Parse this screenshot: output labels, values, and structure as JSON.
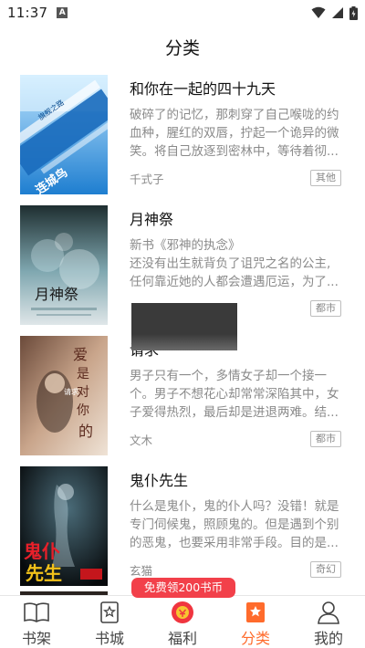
{
  "status_bar": {
    "time": "11:37",
    "notification_letter": "A"
  },
  "header": {
    "title": "分类"
  },
  "books": [
    {
      "title": "和你在一起的四十九天",
      "description_lines": [
        "破碎了的记忆，那刺穿了自己喉咙的约",
        "血种，腥红的双唇，拧起一个诡异的微",
        "笑。将自己放逐到密林中，等待着彻..."
      ],
      "author": "千式子",
      "tag": "其他",
      "cover_text": [
        "旗舰之路",
        "连城鸟"
      ]
    },
    {
      "title": "月神祭",
      "description_lines": [
        "新书《邪神的执念》",
        "还没有出生就背负了诅咒之名的公主,",
        "任何靠近她的人都会遭遇厄运，为了..."
      ],
      "author": "",
      "tag": "都市",
      "cover_text": [
        "月神祭"
      ]
    },
    {
      "title": "请求",
      "description_lines": [
        "男子只有一个，多情女子却一个接一",
        "个。男子不想花心却常常深陷其中，女",
        "子爱得热烈，最后却是进退两难。结..."
      ],
      "author": "文木",
      "tag": "都市",
      "cover_text": [
        "爱",
        "是",
        "对",
        "你",
        "的",
        "请求"
      ]
    },
    {
      "title": "鬼仆先生",
      "description_lines": [
        "什么是鬼仆，鬼的仆人吗？没错！就是",
        "专门伺候鬼，照顾鬼的。但是遇到个别",
        "的恶鬼，也要采用非常手段。目的是..."
      ],
      "author": "玄猫",
      "tag": "奇幻",
      "cover_text": [
        "鬼仆",
        "先生"
      ]
    }
  ],
  "promo": {
    "label": "免费领200书币"
  },
  "tabs": [
    {
      "label": "书架",
      "icon": "book-open-icon"
    },
    {
      "label": "书城",
      "icon": "bookmark-star-icon"
    },
    {
      "label": "福利",
      "icon": "gift-coin-icon"
    },
    {
      "label": "分类",
      "icon": "category-star-icon"
    },
    {
      "label": "我的",
      "icon": "person-icon"
    }
  ],
  "colors": {
    "accent": "#ff6b2c",
    "promo": "#f2404a",
    "text_muted": "#8a8a8a"
  }
}
